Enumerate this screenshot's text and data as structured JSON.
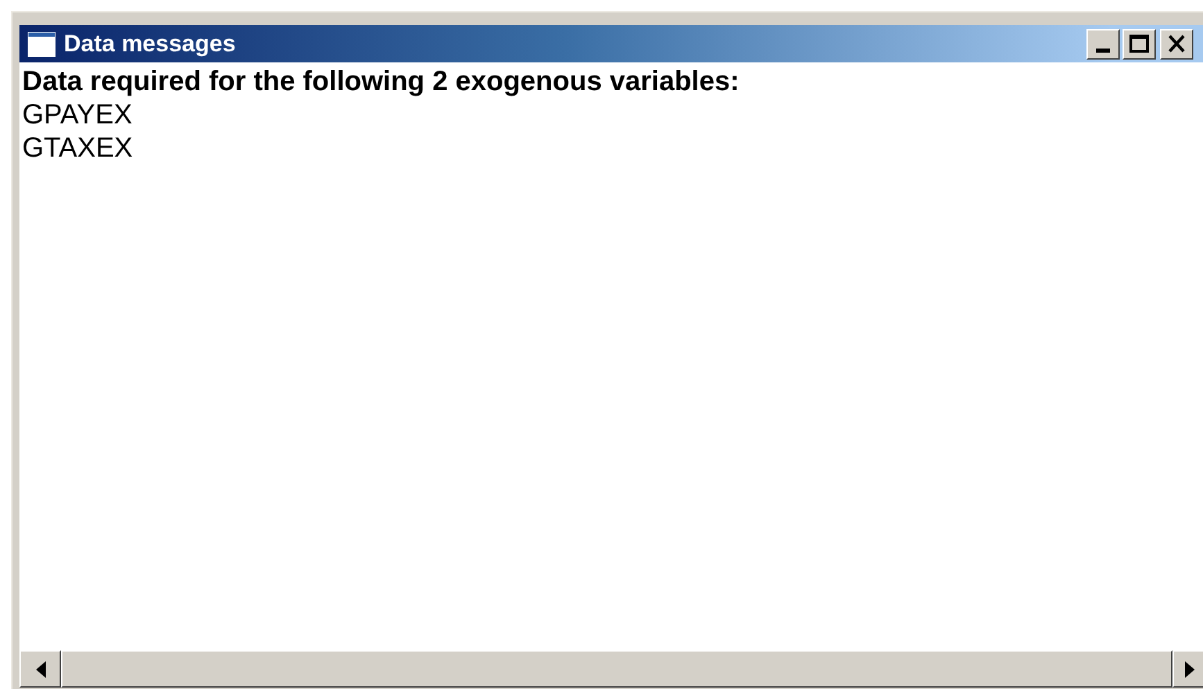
{
  "window": {
    "title": "Data messages"
  },
  "messages": [
    "Data required for the following 2 exogenous variables:",
    "GPAYEX",
    "GTAXEX"
  ]
}
